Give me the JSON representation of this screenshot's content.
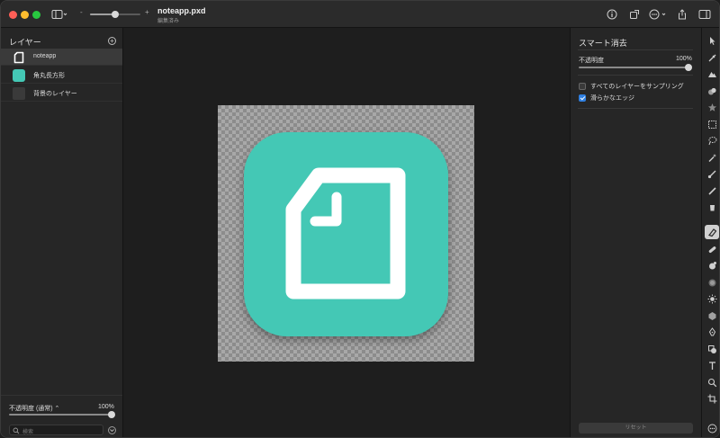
{
  "titlebar": {
    "doc_title": "noteapp.pxd",
    "doc_subtitle": "編集済み",
    "zoom_minus": "-",
    "zoom_plus": "+",
    "traffic_colors": [
      "#ff5f57",
      "#febc2e",
      "#28c840"
    ]
  },
  "layers_panel": {
    "title": "レイヤー",
    "items": [
      {
        "label": "noteapp",
        "thumb": "doc-icon",
        "selected": true
      },
      {
        "label": "角丸長方形",
        "thumb_color": "#44c8b5",
        "selected": false
      },
      {
        "label": "背景のレイヤー",
        "thumb_color": "#3a3a3a",
        "selected": false
      }
    ],
    "opacity_label": "不透明度 (通常) ⌃",
    "opacity_value": "100%",
    "opacity_fraction": 1.0,
    "search_placeholder": "検索"
  },
  "canvas": {
    "tile_color": "#44c8b5",
    "glyph_color": "#ffffff"
  },
  "smart_erase": {
    "title": "スマート消去",
    "opacity_label": "不透明度",
    "opacity_value": "100%",
    "opacity_fraction": 1.0,
    "options": [
      {
        "label": "すべてのレイヤーをサンプリング",
        "checked": false
      },
      {
        "label": "滑らかなエッジ",
        "checked": true
      }
    ],
    "reset_label": "リセット"
  },
  "tools": [
    "arrow-icon",
    "pipette-icon",
    "mountain-icon",
    "shapes-icon",
    "star-icon",
    "marquee-icon",
    "lasso-icon",
    "magic-wand-icon",
    "brush-icon",
    "pencil-icon",
    "bucket-icon",
    "eraser-icon",
    "bandage-icon",
    "clone-icon",
    "blur-icon",
    "brightness-icon",
    "sponge-icon",
    "pen-icon",
    "shape-icon",
    "text-icon",
    "zoom-icon",
    "crop-icon",
    "more-icon"
  ],
  "accent": "#2f7fe0"
}
